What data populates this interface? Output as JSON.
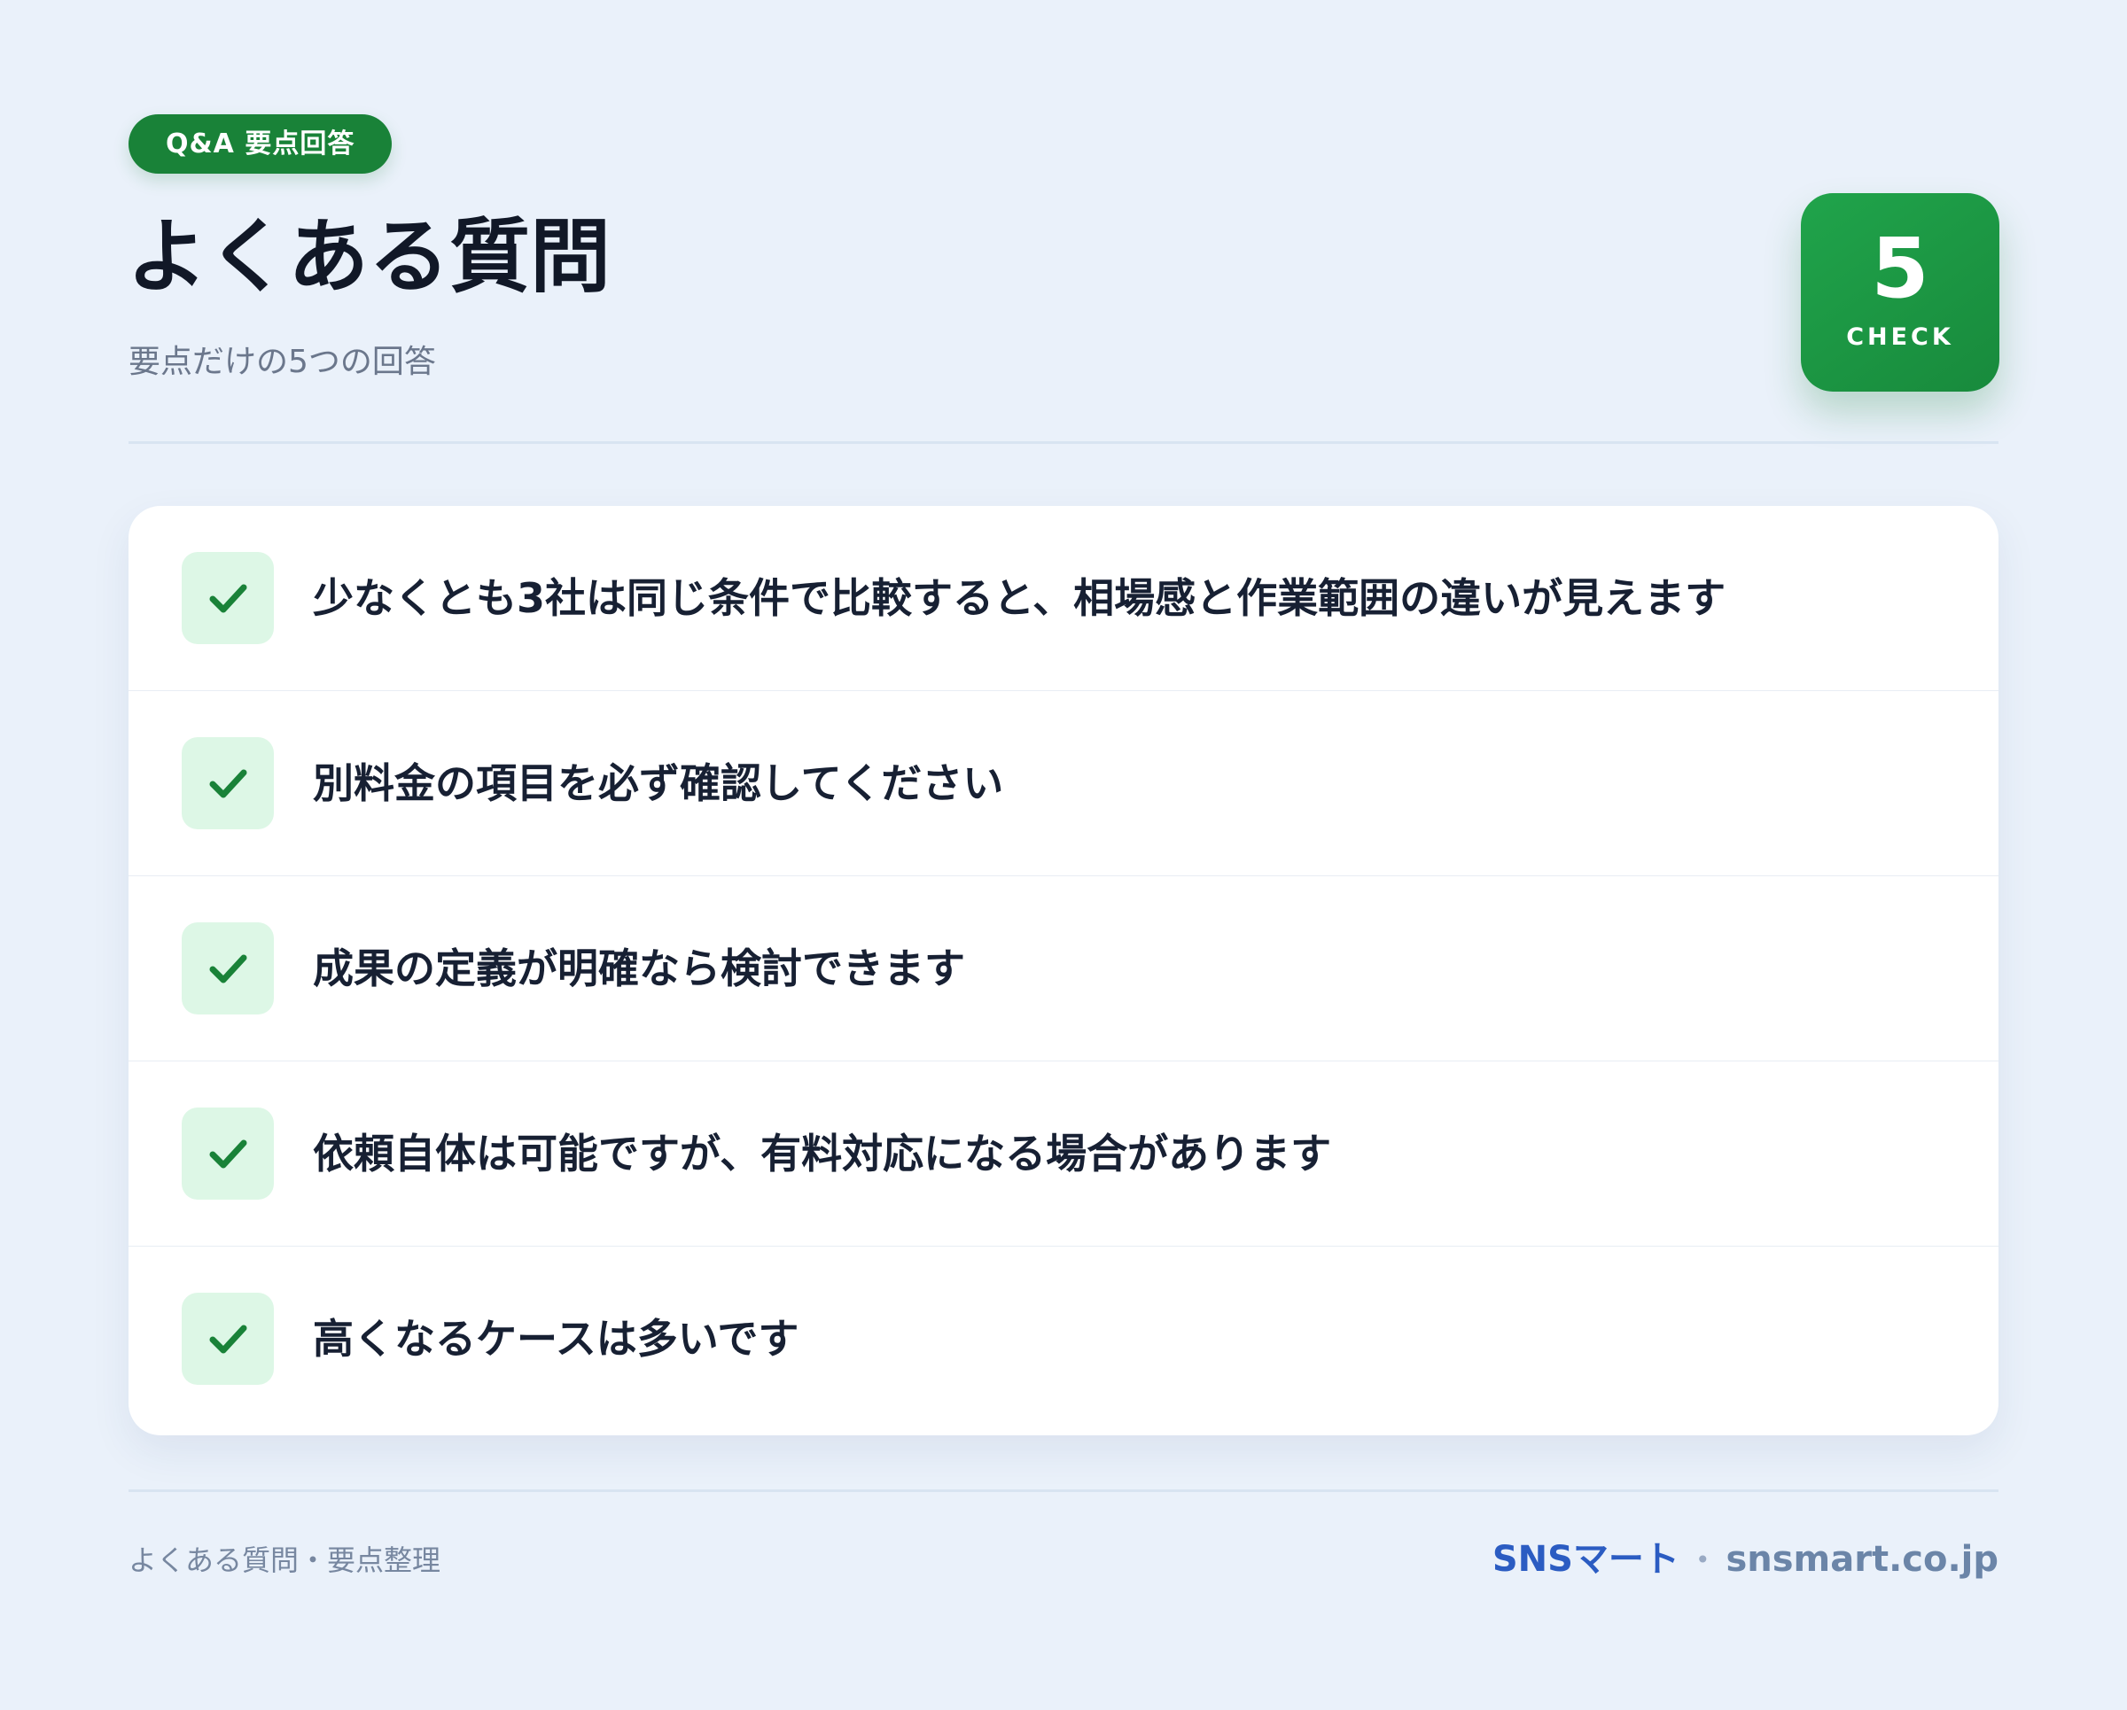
{
  "header": {
    "tag": "Q&A 要点回答",
    "title": "よくある質問",
    "subtitle": "要点だけの5つの回答"
  },
  "badge": {
    "count": "5",
    "label": "CHECK",
    "accent": "#198238"
  },
  "faq": {
    "items": [
      {
        "text": "少なくとも3社は同じ条件で比較すると、相場感と作業範囲の違いが見えます",
        "icon": "check-icon"
      },
      {
        "text": "別料金の項目を必ず確認してください",
        "icon": "check-icon"
      },
      {
        "text": "成果の定義が明確なら検討できます",
        "icon": "check-icon"
      },
      {
        "text": "依頼自体は可能ですが、有料対応になる場合があります",
        "icon": "check-icon"
      },
      {
        "text": "高くなるケースは多いです",
        "icon": "check-icon"
      }
    ]
  },
  "footer": {
    "left": "よくある質問・要点整理",
    "brand": "SNSマート",
    "separator": "•",
    "domain": "snsmart.co.jp"
  }
}
